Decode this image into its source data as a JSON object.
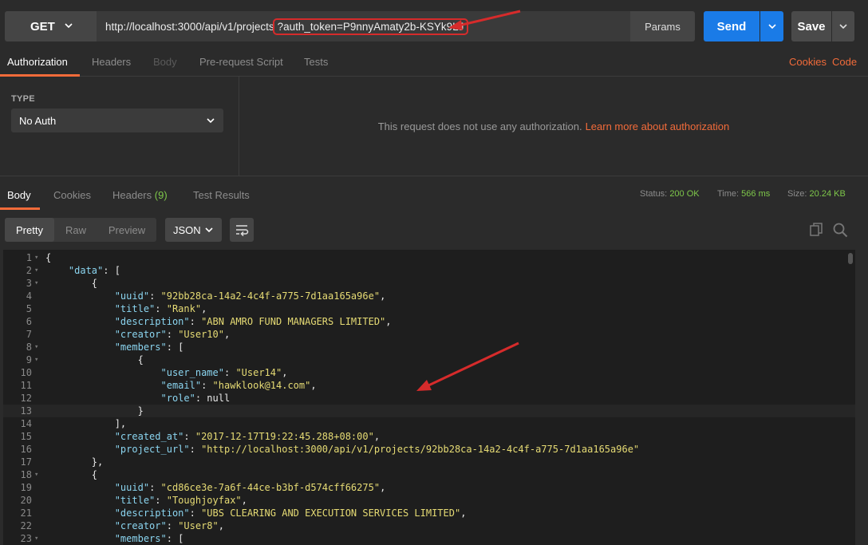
{
  "request": {
    "method": "GET",
    "url_base": "http://localhost:3000/api/v1/projects",
    "url_query": "?auth_token=P9nnyAmaty2b-KSYk9LJ",
    "params_label": "Params",
    "send_label": "Send",
    "save_label": "Save"
  },
  "request_tabs": [
    "Authorization",
    "Headers",
    "Body",
    "Pre-request Script",
    "Tests"
  ],
  "request_links": [
    "Cookies",
    "Code"
  ],
  "auth": {
    "type_label": "TYPE",
    "type_value": "No Auth",
    "message": "This request does not use any authorization.",
    "learn_more": "Learn more about authorization"
  },
  "response_tabs": {
    "body": "Body",
    "cookies": "Cookies",
    "headers": "Headers",
    "headers_count": "(9)",
    "test_results": "Test Results"
  },
  "status": {
    "status_label": "Status:",
    "status_value": "200 OK",
    "time_label": "Time:",
    "time_value": "566 ms",
    "size_label": "Size:",
    "size_value": "20.24 KB"
  },
  "view": {
    "modes": [
      "Pretty",
      "Raw",
      "Preview"
    ],
    "format": "JSON"
  },
  "colors": {
    "accent": "#f26b3a",
    "send": "#1a7be7",
    "status_green": "#7ec74a",
    "annotation": "#d62b2b"
  },
  "code_lines": [
    {
      "n": "1",
      "fold": true,
      "t": "{"
    },
    {
      "n": "2",
      "fold": true,
      "t": "    \"data\": ["
    },
    {
      "n": "3",
      "fold": true,
      "t": "        {"
    },
    {
      "n": "4",
      "fold": false,
      "t": "            \"uuid\": \"92bb28ca-14a2-4c4f-a775-7d1aa165a96e\","
    },
    {
      "n": "5",
      "fold": false,
      "t": "            \"title\": \"Rank\","
    },
    {
      "n": "6",
      "fold": false,
      "t": "            \"description\": \"ABN AMRO FUND MANAGERS LIMITED\","
    },
    {
      "n": "7",
      "fold": false,
      "t": "            \"creator\": \"User10\","
    },
    {
      "n": "8",
      "fold": true,
      "t": "            \"members\": ["
    },
    {
      "n": "9",
      "fold": true,
      "t": "                {"
    },
    {
      "n": "10",
      "fold": false,
      "t": "                    \"user_name\": \"User14\","
    },
    {
      "n": "11",
      "fold": false,
      "t": "                    \"email\": \"hawklook@14.com\","
    },
    {
      "n": "12",
      "fold": false,
      "t": "                    \"role\": null"
    },
    {
      "n": "13",
      "fold": false,
      "t": "                }"
    },
    {
      "n": "14",
      "fold": false,
      "t": "            ],"
    },
    {
      "n": "15",
      "fold": false,
      "t": "            \"created_at\": \"2017-12-17T19:22:45.288+08:00\","
    },
    {
      "n": "16",
      "fold": false,
      "t": "            \"project_url\": \"http://localhost:3000/api/v1/projects/92bb28ca-14a2-4c4f-a775-7d1aa165a96e\""
    },
    {
      "n": "17",
      "fold": false,
      "t": "        },"
    },
    {
      "n": "18",
      "fold": true,
      "t": "        {"
    },
    {
      "n": "19",
      "fold": false,
      "t": "            \"uuid\": \"cd86ce3e-7a6f-44ce-b3bf-d574cff66275\","
    },
    {
      "n": "20",
      "fold": false,
      "t": "            \"title\": \"Toughjoyfax\","
    },
    {
      "n": "21",
      "fold": false,
      "t": "            \"description\": \"UBS CLEARING AND EXECUTION SERVICES LIMITED\","
    },
    {
      "n": "22",
      "fold": false,
      "t": "            \"creator\": \"User8\","
    },
    {
      "n": "23",
      "fold": true,
      "t": "            \"members\": ["
    }
  ]
}
